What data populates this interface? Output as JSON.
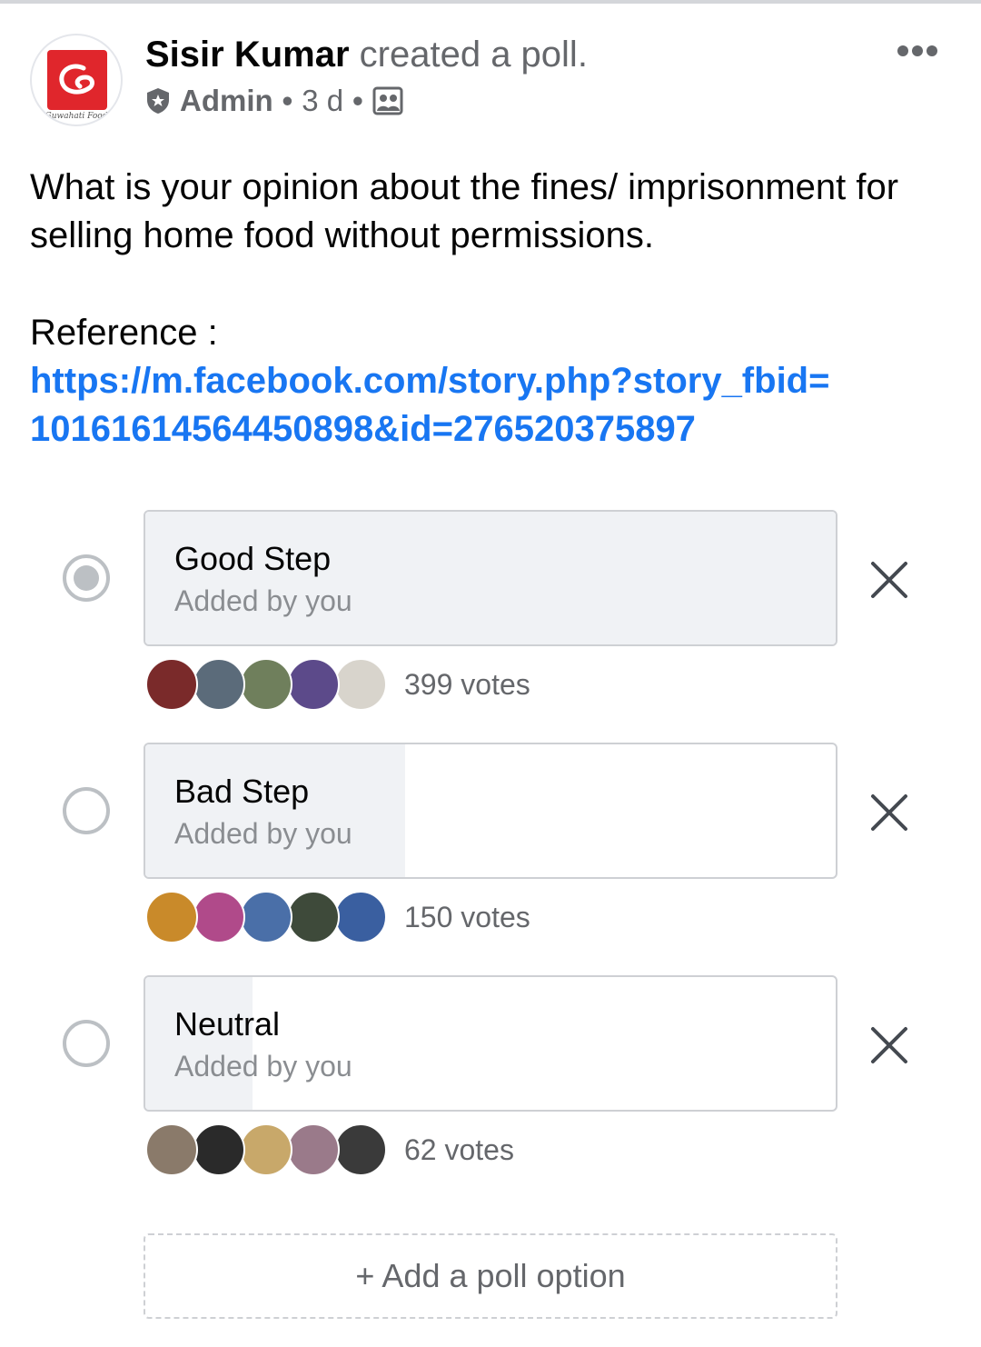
{
  "post": {
    "author_name": "Sisir Kumar",
    "author_action": "created a poll.",
    "role": "Admin",
    "separator": "•",
    "time": "3 d",
    "avatar_caption": "Guwahati Food",
    "text": "What is your opinion about the fines/ imprisonment for selling home food without permissions.",
    "reference_label": "Reference :",
    "reference_link": "https://m.facebook.com/story.php?story_fbid=10161614564450898&id=276520375897"
  },
  "icons": {
    "more": "more-dots-icon",
    "admin": "shield-icon",
    "audience": "group-icon",
    "remove": "close-icon"
  },
  "colors": {
    "link": "#1876f2",
    "logo": "#e0262c",
    "secondary_text": "#65676b",
    "option_fill": "#f0f2f5"
  },
  "poll": {
    "options": [
      {
        "label": "Good Step",
        "sub": "Added by you",
        "votes_label": "399 votes",
        "votes": 399,
        "fill_fraction": 1.0,
        "selected": true,
        "voter_colors": [
          "#7a2a2a",
          "#5b6b7a",
          "#6f7f5c",
          "#5c4a8a",
          "#d8d4cc"
        ]
      },
      {
        "label": "Bad Step",
        "sub": "Added by you",
        "votes_label": "150 votes",
        "votes": 150,
        "fill_fraction": 0.376,
        "selected": false,
        "voter_colors": [
          "#c98a2a",
          "#b04a8a",
          "#4a6fa8",
          "#3e4a3a",
          "#3a5fa0"
        ]
      },
      {
        "label": "Neutral",
        "sub": "Added by you",
        "votes_label": "62 votes",
        "votes": 62,
        "fill_fraction": 0.155,
        "selected": false,
        "voter_colors": [
          "#8a7a6a",
          "#2a2a2a",
          "#c8a86a",
          "#9a7a8a",
          "#3a3a3a"
        ]
      }
    ],
    "add_option_label": "+ Add a poll option"
  }
}
